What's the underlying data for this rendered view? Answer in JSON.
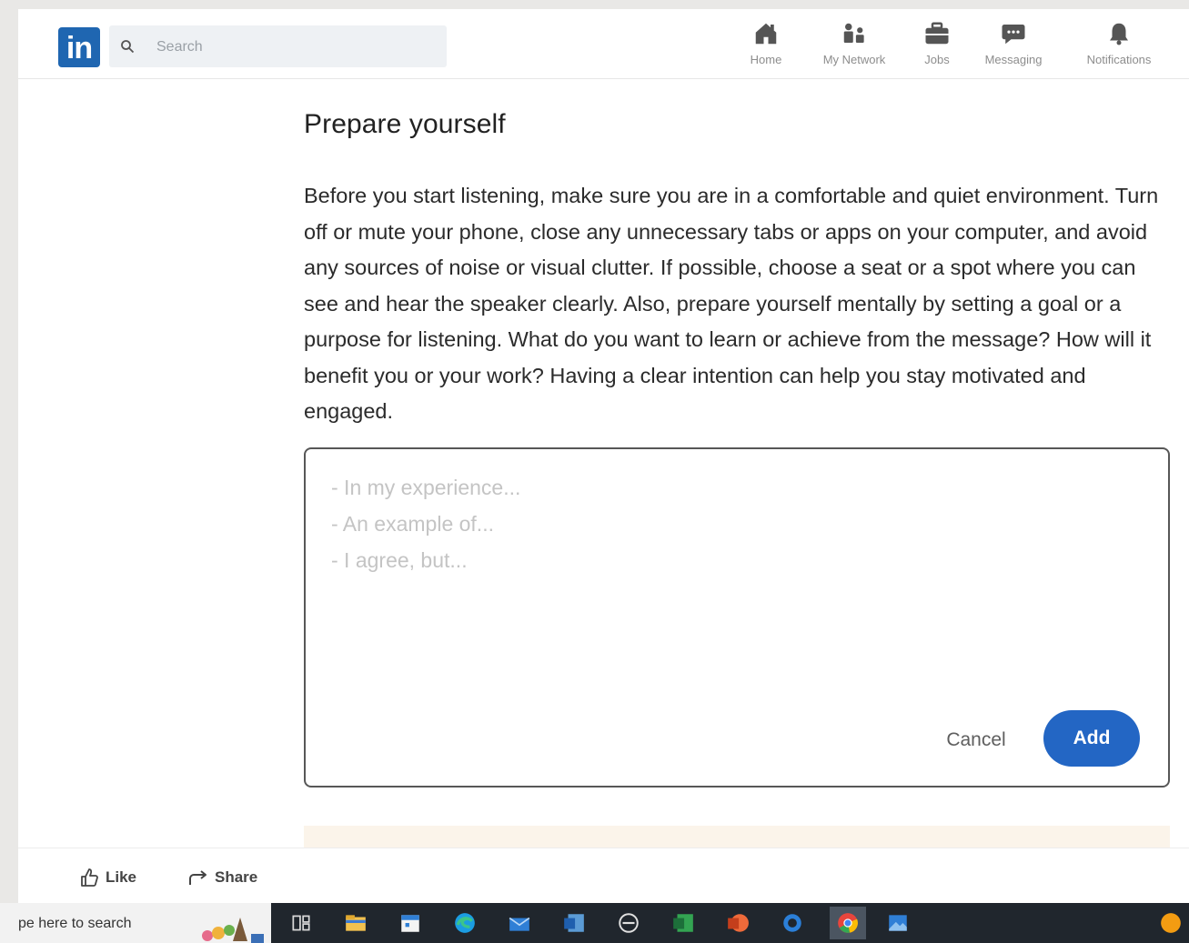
{
  "nav": {
    "brand": "in",
    "search_placeholder": "Search",
    "items": [
      {
        "label": "Home",
        "icon": "home-icon"
      },
      {
        "label": "My Network",
        "icon": "network-icon"
      },
      {
        "label": "Jobs",
        "icon": "briefcase-icon"
      },
      {
        "label": "Messaging",
        "icon": "messaging-icon"
      },
      {
        "label": "Notifications",
        "icon": "bell-icon"
      }
    ]
  },
  "article": {
    "heading": "Prepare yourself",
    "body": "Before you start listening, make sure you are in a comfortable and quiet environment. Turn off or mute your phone, close any unnecessary tabs or apps on your computer, and avoid any sources of noise or visual clutter. If possible, choose a seat or a spot where you can see and hear the speaker clearly. Also, prepare yourself mentally by setting a goal or a purpose for listening. What do you want to learn or achieve from the message? How will it benefit you or your work? Having a clear intention can help you stay motivated and engaged."
  },
  "contribution": {
    "placeholder": "- In my experience...\n- An example of...\n- I agree, but...",
    "cancel_label": "Cancel",
    "add_label": "Add"
  },
  "actions": {
    "like_label": "Like",
    "share_label": "Share"
  },
  "taskbar": {
    "search_placeholder": "pe here to search",
    "apps": [
      "task-view-icon",
      "file-explorer-icon",
      "calendar-icon",
      "edge-icon",
      "mail-icon",
      "word-icon",
      "dell-icon",
      "excel-icon",
      "powerpoint-icon",
      "cortana-icon",
      "chrome-icon",
      "photos-icon",
      "tray-icon"
    ]
  },
  "colors": {
    "brand_blue": "#1f66b1",
    "add_button": "#2366c4",
    "taskbar": "#20262d"
  }
}
